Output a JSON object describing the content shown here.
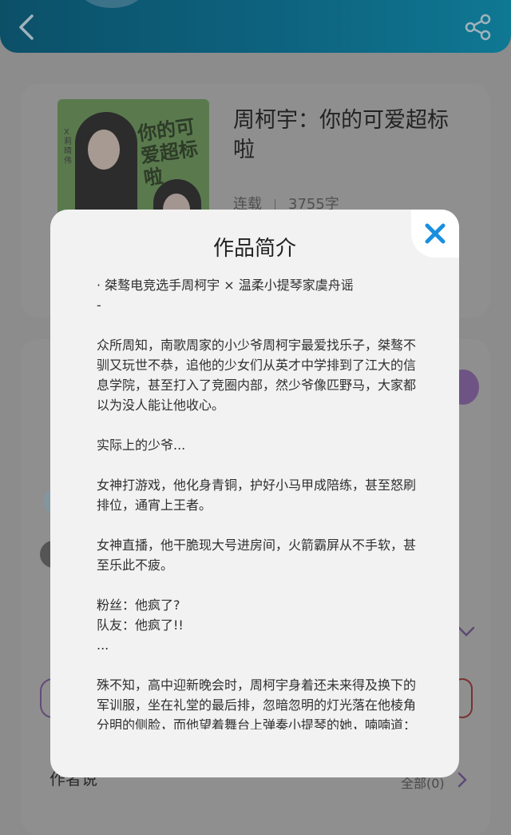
{
  "colors": {
    "header_gradient": [
      "#0c5068",
      "#0f7893"
    ],
    "dim_overlay": "#8c8c8c",
    "modal_bg": "#f2f2f2",
    "close_icon": "#1a8fe0"
  },
  "header": {
    "back_icon": "chevron-left-icon",
    "share_icon": "share-icon"
  },
  "book": {
    "title": "周柯宇：你的可爱超标啦",
    "status": "连载",
    "word_count": "3755字",
    "cover": {
      "cover_title": "你的可爱超标啦",
      "cover_author": "X莉晴伟"
    }
  },
  "background": {
    "comments_label": "作者说",
    "comments_count": "全部(0)"
  },
  "modal": {
    "title": "作品简介",
    "close_icon": "close-icon",
    "paragraphs": [
      "· 桀骜电竞选手周柯宇 × 温柔小提琴家虞舟谣\n-",
      "众所周知，南歌周家的小少爷周柯宇最爱找乐子，桀骜不驯又玩世不恭，追他的少女们从英才中学排到了江大的信息学院，甚至打入了竞圈内部，然少爷像匹野马，大家都以为没人能让他收心。",
      "实际上的少爷...",
      "女神打游戏，他化身青铜，护好小马甲成陪练，甚至怒刷排位，通宵上王者。",
      "女神直播，他干脆现大号进房间，火箭霸屏从不手软，甚至乐此不疲。",
      "粉丝：他疯了?\n队友：他疯了!!\n...",
      "殊不知，高中迎新晚会时，周柯宇身着还未来得及换下的军训服，坐在礼堂的最后排，忽暗忽明的灯光落在他棱角分明的侧脸，而他望着舞台上弹奏小提琴的她，喃喃道："
    ]
  }
}
